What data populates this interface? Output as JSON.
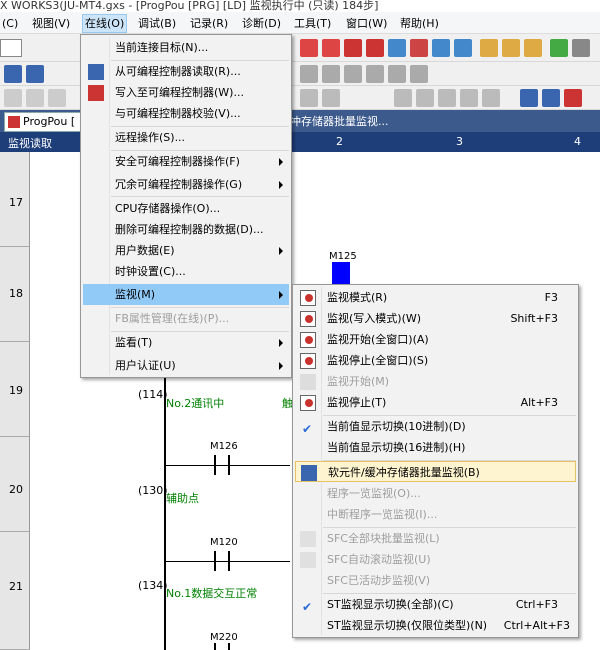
{
  "window": {
    "title": "X WORKS3(JU-MT4.gxs - [ProgPou [PRG] [LD] 监视执行中 (只读) 184步]"
  },
  "menubar": [
    {
      "label": "(C)"
    },
    {
      "label": "视图(V)"
    },
    {
      "label": "在线(O)"
    },
    {
      "label": "调试(B)"
    },
    {
      "label": "记录(R)"
    },
    {
      "label": "诊断(D)"
    },
    {
      "label": "工具(T)"
    },
    {
      "label": "窗口(W)"
    },
    {
      "label": "帮助(H)"
    }
  ],
  "document": {
    "tab_label": "ProgPou [",
    "title_partial": "冲存储器批量监视..."
  },
  "grid_header": {
    "left": "监视读取",
    "cols": [
      "1",
      "2",
      "3",
      "4"
    ]
  },
  "ladder": {
    "rows": [
      "17",
      "18",
      "19",
      "20",
      "21"
    ],
    "steps": [
      "(114)",
      "(130)",
      "(134)"
    ],
    "comments": [
      "No.2通讯中",
      "辅助点",
      "No.1数据交互正常"
    ],
    "partial_char": "触",
    "devices": [
      "M125",
      "M126",
      "M120",
      "M220"
    ]
  },
  "online_menu": {
    "items": [
      {
        "label": "当前连接目标(N)..."
      },
      {
        "label": "从可编程控制器读取(R)..."
      },
      {
        "label": "写入至可编程控制器(W)..."
      },
      {
        "label": "与可编程控制器校验(V)..."
      },
      {
        "label": "远程操作(S)..."
      },
      {
        "label": "安全可编程控制器操作(F)"
      },
      {
        "label": "冗余可编程控制器操作(G)"
      },
      {
        "label": "CPU存储器操作(O)..."
      },
      {
        "label": "删除可编程控制器的数据(D)..."
      },
      {
        "label": "用户数据(E)"
      },
      {
        "label": "时钟设置(C)..."
      },
      {
        "label": "监视(M)"
      },
      {
        "label": "FB属性管理(在线)(P)..."
      },
      {
        "label": "监看(T)"
      },
      {
        "label": "用户认证(U)"
      }
    ]
  },
  "monitor_menu": {
    "items": [
      {
        "label": "监视模式(R)",
        "shortcut": "F3"
      },
      {
        "label": "监视(写入模式)(W)",
        "shortcut": "Shift+F3"
      },
      {
        "label": "监视开始(全窗口)(A)",
        "shortcut": ""
      },
      {
        "label": "监视停止(全窗口)(S)",
        "shortcut": ""
      },
      {
        "label": "监视开始(M)",
        "shortcut": ""
      },
      {
        "label": "监视停止(T)",
        "shortcut": "Alt+F3"
      },
      {
        "label": "当前值显示切换(10进制)(D)",
        "shortcut": ""
      },
      {
        "label": "当前值显示切换(16进制)(H)",
        "shortcut": ""
      },
      {
        "label": "软元件/缓冲存储器批量监视(B)",
        "shortcut": ""
      },
      {
        "label": "程序一览监视(O)...",
        "shortcut": ""
      },
      {
        "label": "中断程序一览监视(I)...",
        "shortcut": ""
      },
      {
        "label": "SFC全部块批量监视(L)",
        "shortcut": ""
      },
      {
        "label": "SFC自动滚动监视(U)",
        "shortcut": ""
      },
      {
        "label": "SFC已活动步监视(V)",
        "shortcut": ""
      },
      {
        "label": "ST监视显示切换(全部)(C)",
        "shortcut": "Ctrl+F3"
      },
      {
        "label": "ST监视显示切换(仅限位类型)(N)",
        "shortcut": "Ctrl+Alt+F3"
      }
    ]
  },
  "colors": {
    "highlight": "#91c9f7",
    "hover": "#fff4d0",
    "grid_header": "#1e3e7a",
    "comment": "#008000",
    "monitor_on": "#0000ff"
  }
}
